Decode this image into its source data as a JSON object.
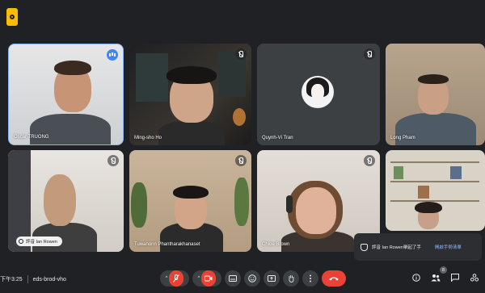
{
  "meeting": {
    "time": "下午3:25",
    "code": "eds-brod-vho",
    "participant_count": "8"
  },
  "tiles": [
    {
      "name": "Oscar TRUONG",
      "status": "speaking"
    },
    {
      "name": "Ming-sho Ho",
      "status": "muted"
    },
    {
      "name": "Quynh-Vi Tran",
      "status": "muted"
    },
    {
      "name": "Long Pham",
      "status": "none"
    },
    {
      "name": "",
      "status": "muted"
    },
    {
      "name": "Tuwanonn Phantharakhanaset",
      "status": "muted"
    },
    {
      "name": "Chloe Brown",
      "status": "muted"
    },
    {
      "name": "",
      "status": "none"
    }
  ],
  "caption_chip": {
    "label": "評音 Ian Rowen"
  },
  "toast": {
    "message": "評音 Ian Rowen舉起了手",
    "action": "開啟手勢清單"
  },
  "controls": {
    "icons": [
      "chevron-up-icon",
      "mic-off-icon",
      "chevron-up-icon",
      "camera-icon",
      "captions-icon",
      "emoji-icon",
      "present-icon",
      "raise-hand-icon",
      "more-vert-icon",
      "hangup-icon"
    ],
    "right_icons": [
      "info-icon",
      "people-icon",
      "chat-icon",
      "activities-icon"
    ]
  },
  "colors": {
    "background": "#202124",
    "tile": "#3c4043",
    "accent_red": "#ea4335",
    "speaking_blue": "#4285f4",
    "link_blue": "#8ab4f8",
    "app_badge": "#fbbc04"
  }
}
